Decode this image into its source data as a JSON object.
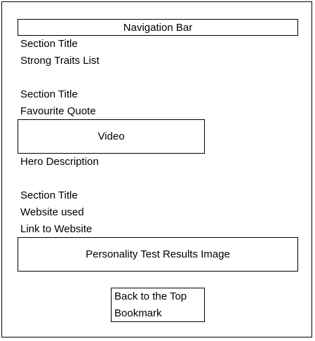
{
  "navigation_bar": "Navigation Bar",
  "section1": {
    "title": "Section Title",
    "content": "Strong Traits List"
  },
  "section2": {
    "title": "Section Title",
    "quote": "Favourite Quote",
    "video": "Video",
    "hero": "Hero Description"
  },
  "section3": {
    "title": "Section Title",
    "website": "Website used",
    "link": "Link to Website",
    "image": "Personality Test Results Image"
  },
  "bookmark": {
    "line1": "Back to the Top",
    "line2": "Bookmark"
  }
}
